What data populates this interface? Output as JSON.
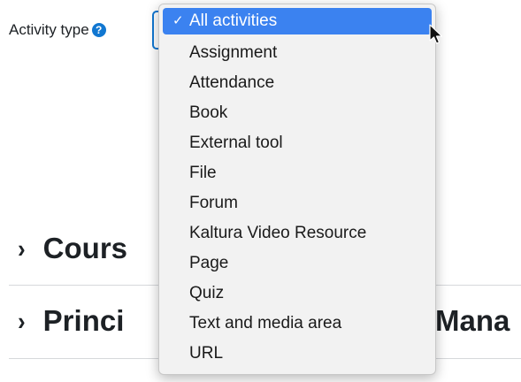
{
  "filter": {
    "label": "Activity type",
    "help_glyph": "?"
  },
  "sections": [
    {
      "chevron": "›",
      "title": "Cours"
    },
    {
      "chevron": "›",
      "title": "Princi",
      "title_right": "Mana"
    }
  ],
  "bottom_fragment": "   ",
  "dropdown": {
    "check_glyph": "✓",
    "options": [
      {
        "label": "All activities",
        "selected": true
      },
      {
        "label": "Assignment"
      },
      {
        "label": "Attendance"
      },
      {
        "label": "Book"
      },
      {
        "label": "External tool"
      },
      {
        "label": "File"
      },
      {
        "label": "Forum"
      },
      {
        "label": "Kaltura Video Resource"
      },
      {
        "label": "Page"
      },
      {
        "label": "Quiz"
      },
      {
        "label": "Text and media area"
      },
      {
        "label": "URL"
      }
    ]
  },
  "colors": {
    "accent": "#1177d1",
    "selected_bg": "#3b82f0",
    "menu_bg": "#f2f2f2"
  },
  "icons": {
    "help": "help-icon",
    "check": "check-icon",
    "chevron": "chevron-right-icon",
    "cursor": "mouse-pointer-icon"
  }
}
